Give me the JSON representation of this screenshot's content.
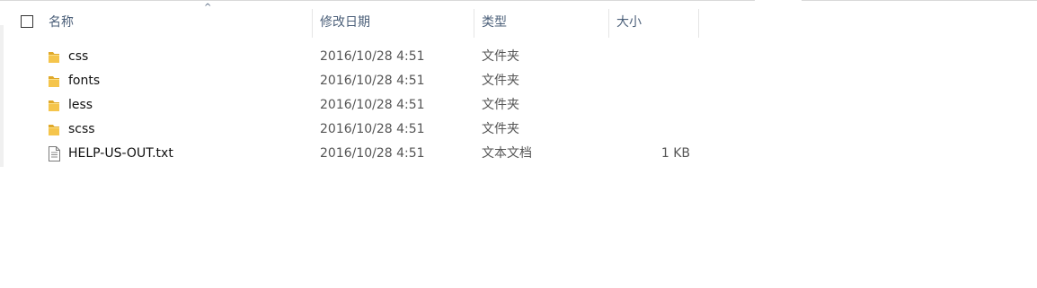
{
  "header": {
    "name_label": "名称",
    "date_label": "修改日期",
    "type_label": "类型",
    "size_label": "大小",
    "sort_indicator": "^"
  },
  "files": [
    {
      "name": "css",
      "date": "2016/10/28 4:51",
      "type": "文件夹",
      "size": "",
      "icon": "folder-icon"
    },
    {
      "name": "fonts",
      "date": "2016/10/28 4:51",
      "type": "文件夹",
      "size": "",
      "icon": "folder-icon"
    },
    {
      "name": "less",
      "date": "2016/10/28 4:51",
      "type": "文件夹",
      "size": "",
      "icon": "folder-icon"
    },
    {
      "name": "scss",
      "date": "2016/10/28 4:51",
      "type": "文件夹",
      "size": "",
      "icon": "folder-icon"
    },
    {
      "name": "HELP-US-OUT.txt",
      "date": "2016/10/28 4:51",
      "type": "文本文档",
      "size": "1 KB",
      "icon": "text-file-icon"
    }
  ],
  "colors": {
    "header_text": "#4c607a",
    "folder_yellow": "#f5c54c",
    "folder_dark": "#e0a92a"
  }
}
